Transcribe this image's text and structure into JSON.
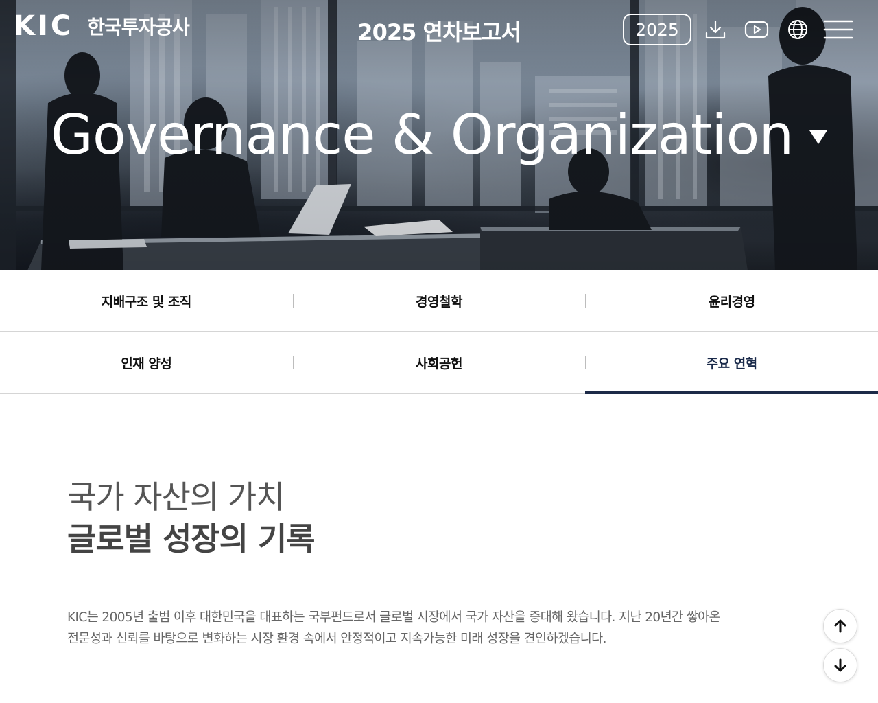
{
  "header": {
    "logo_mark": "KIC",
    "logo_name": "한국투자공사",
    "report_title": "2025 연차보고서",
    "year_button": "2025",
    "icons": [
      "download-icon",
      "youtube-icon",
      "globe-icon",
      "menu-icon"
    ]
  },
  "hero": {
    "heading": "Governance & Organization"
  },
  "tabs": {
    "row1": [
      {
        "label": "지배구조 및 조직"
      },
      {
        "label": "경영철학"
      },
      {
        "label": "윤리경영"
      }
    ],
    "row2": [
      {
        "label": "인재 양성"
      },
      {
        "label": "사회공헌"
      },
      {
        "label": "주요 연혁"
      }
    ],
    "active": "주요 연혁"
  },
  "content": {
    "title_line1": "국가 자산의 가치",
    "title_line2": "글로벌 성장의 기록",
    "description_line1": "KIC는 2005년 출범 이후 대한민국을 대표하는 국부펀드로서 글로벌 시장에서 국가 자산을 증대해 왔습니다. 지난 20년간 쌓아온",
    "description_line2": "전문성과 신뢰를 바탕으로 변화하는 시장 환경 속에서 안정적이고 지속가능한 미래 성장을 견인하겠습니다."
  },
  "floating": {
    "icons": [
      "arrow-up-icon",
      "arrow-down-icon"
    ]
  },
  "colors": {
    "active_tab_underline": "#1c2a48",
    "tab_border": "#d5d5d5"
  }
}
